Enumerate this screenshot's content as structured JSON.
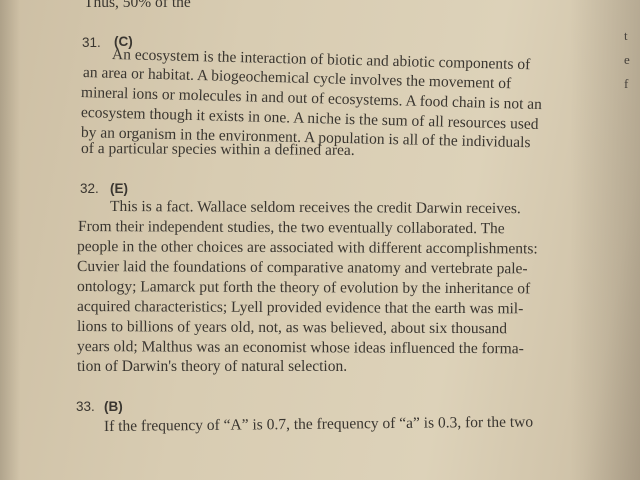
{
  "top_fragment": "Thus, 50% of the",
  "side_marks": [
    "t",
    "e",
    "f"
  ],
  "questions": [
    {
      "number": "31.",
      "answer": "(C)",
      "lines": [
        "An ecosystem is the interaction of biotic and abiotic components of",
        "an area or habitat. A biogeochemical cycle involves the movement of",
        "mineral ions or molecules in and out of ecosystems. A food chain is not an",
        "ecosystem though it exists in one. A niche is the sum of all resources used",
        "by an organism in the environment. A population is all of the individuals",
        "of a particular species within a defined area."
      ]
    },
    {
      "number": "32.",
      "answer": "(E)",
      "lines": [
        "This is a fact. Wallace seldom receives the credit Darwin receives.",
        "From their independent studies, the two eventually collaborated. The",
        "people in the other choices are associated with different accomplishments:",
        "Cuvier laid the foundations of comparative anatomy and vertebrate pale-",
        "ontology; Lamarck put forth the theory of evolution by the inheritance of",
        "acquired characteristics; Lyell provided evidence that the earth was mil-",
        "lions to billions of years old, not, as was believed, about six thousand",
        "years old; Malthus was an economist whose ideas influenced the forma-",
        "tion of Darwin's theory of natural selection."
      ]
    },
    {
      "number": "33.",
      "answer": "(B)",
      "lines": [
        "If the frequency of “A” is 0.7, the frequency of “a” is 0.3, for the two"
      ]
    }
  ]
}
